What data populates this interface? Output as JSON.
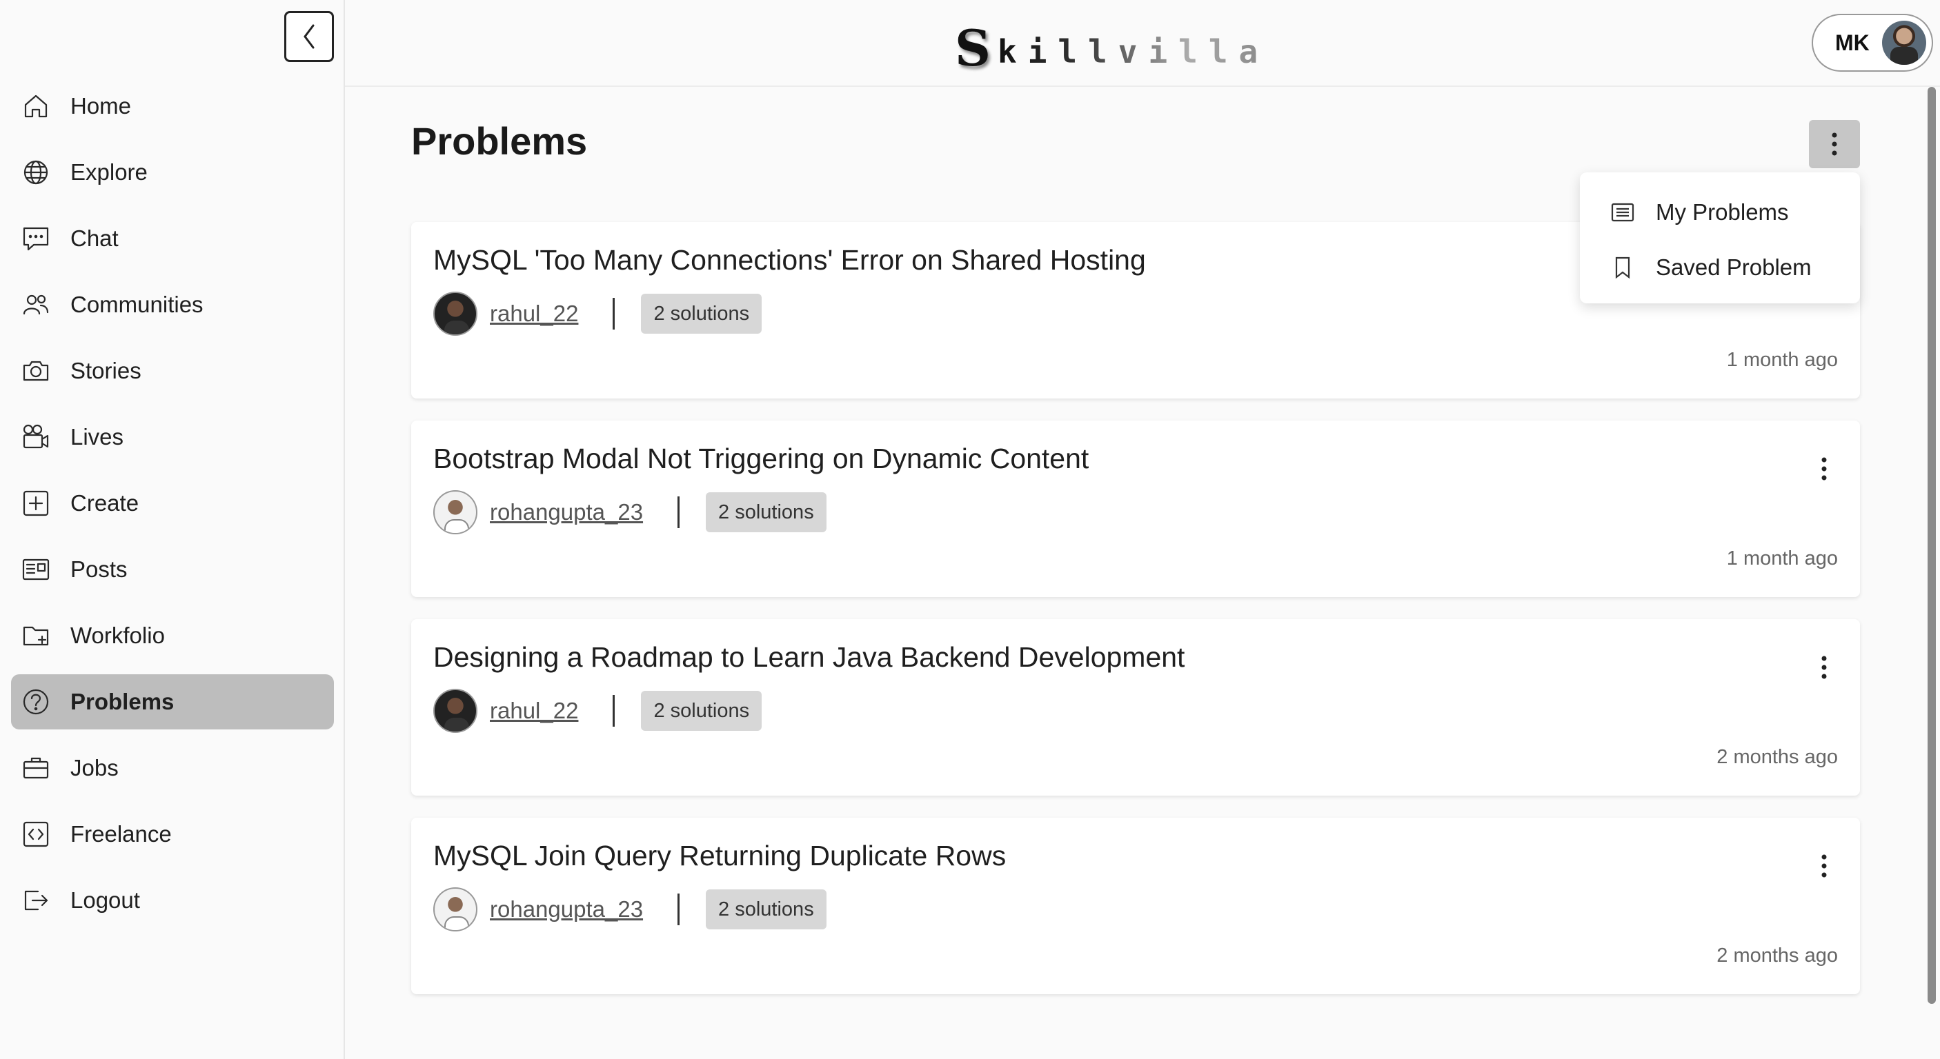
{
  "brand": {
    "logo_first": "S",
    "logo_rest": "killvilla"
  },
  "profile": {
    "initials": "MK"
  },
  "sidebar": {
    "items": [
      {
        "label": "Home",
        "icon": "home-icon"
      },
      {
        "label": "Explore",
        "icon": "globe-icon"
      },
      {
        "label": "Chat",
        "icon": "chat-icon"
      },
      {
        "label": "Communities",
        "icon": "users-icon"
      },
      {
        "label": "Stories",
        "icon": "camera-icon"
      },
      {
        "label": "Lives",
        "icon": "video-icon"
      },
      {
        "label": "Create",
        "icon": "plus-square-icon"
      },
      {
        "label": "Posts",
        "icon": "newspaper-icon"
      },
      {
        "label": "Workfolio",
        "icon": "folder-plus-icon"
      },
      {
        "label": "Problems",
        "icon": "question-circle-icon",
        "active": true
      },
      {
        "label": "Jobs",
        "icon": "briefcase-icon"
      },
      {
        "label": "Freelance",
        "icon": "code-square-icon"
      },
      {
        "label": "Logout",
        "icon": "logout-icon"
      }
    ]
  },
  "main": {
    "title": "Problems",
    "menu": {
      "items": [
        {
          "label": "My Problems",
          "icon": "list-icon"
        },
        {
          "label": "Saved Problem",
          "icon": "bookmark-icon"
        }
      ]
    },
    "problems": [
      {
        "title": "MySQL 'Too Many Connections' Error on Shared Hosting",
        "user": "rahul_22",
        "solutions": "2 solutions",
        "time": "1 month ago",
        "avatar": "dark"
      },
      {
        "title": "Bootstrap Modal Not Triggering on Dynamic Content",
        "user": "rohangupta_23",
        "solutions": "2 solutions",
        "time": "1 month ago",
        "avatar": "light"
      },
      {
        "title": "Designing a Roadmap to Learn Java Backend Development",
        "user": "rahul_22",
        "solutions": "2 solutions",
        "time": "2 months ago",
        "avatar": "dark"
      },
      {
        "title": "MySQL Join Query Returning Duplicate Rows",
        "user": "rohangupta_23",
        "solutions": "2 solutions",
        "time": "2 months ago",
        "avatar": "light"
      }
    ]
  }
}
